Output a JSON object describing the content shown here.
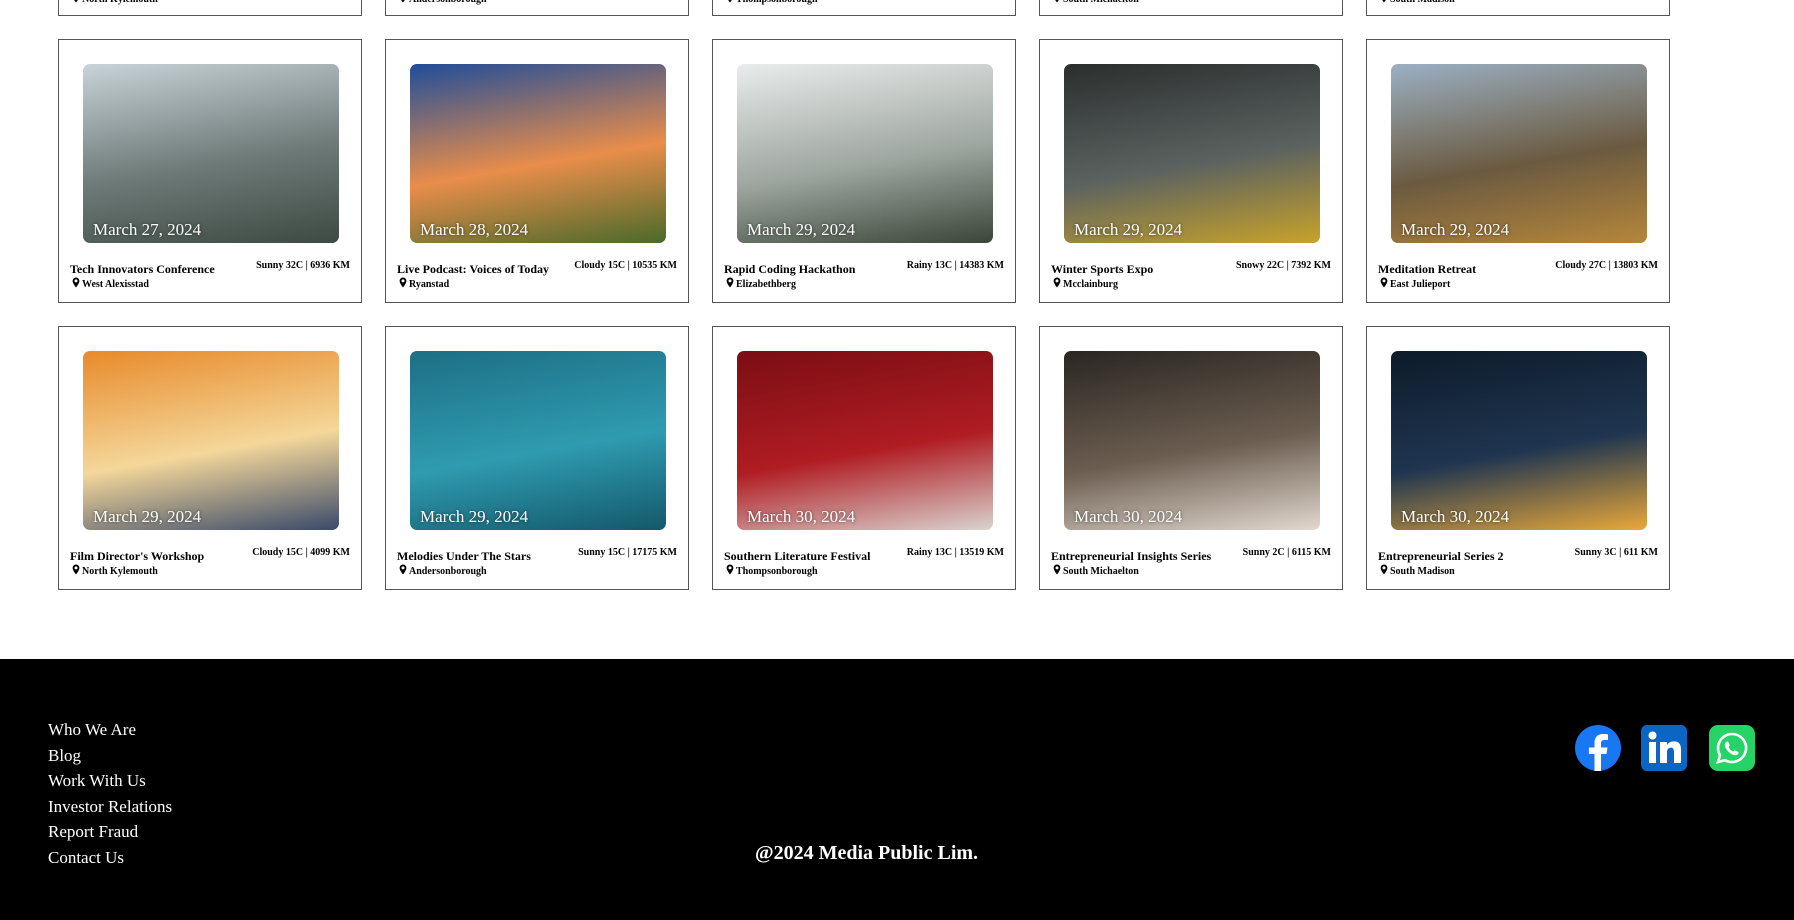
{
  "top_row": [
    {
      "location": "North Kylemouth"
    },
    {
      "location": "Andersonborough"
    },
    {
      "location": "Thompsonborough"
    },
    {
      "location": "South Michaelton"
    },
    {
      "location": "South Madison"
    }
  ],
  "events_row1": [
    {
      "date": "March 27, 2024",
      "title": "Tech Innovators Conference",
      "location": "West Alexisstad",
      "weather": "Sunny 32C | 6936 KM",
      "image": "mountain-fjord-photo",
      "colors": [
        "#c9d3d8",
        "#6d7a78",
        "#3d4a42"
      ]
    },
    {
      "date": "March 28, 2024",
      "title": "Live Podcast: Voices of Today",
      "location": "Ryanstad",
      "weather": "Cloudy 15C | 10535 KM",
      "image": "hot-air-balloons-photo",
      "colors": [
        "#1f4d9a",
        "#e98d4a",
        "#4a6a2a"
      ]
    },
    {
      "date": "March 29, 2024",
      "title": "Rapid Coding Hackathon",
      "location": "Elizabethberg",
      "weather": "Rainy 13C | 14383 KM",
      "image": "mountain-biker-photo",
      "colors": [
        "#e9ecec",
        "#9ea6a0",
        "#3a4638"
      ]
    },
    {
      "date": "March 29, 2024",
      "title": "Winter Sports Expo",
      "location": "Mcclainburg",
      "weather": "Snowy 22C | 7392 KM",
      "image": "kayak-canyon-photo",
      "colors": [
        "#2a2f2e",
        "#5b6260",
        "#c8a22a"
      ]
    },
    {
      "date": "March 29, 2024",
      "title": "Meditation Retreat",
      "location": "East Julieport",
      "weather": "Cloudy 27C | 13803 KM",
      "image": "hikers-mountain-photo",
      "colors": [
        "#9bb0c4",
        "#6b5a40",
        "#b5863a"
      ]
    }
  ],
  "events_row2": [
    {
      "date": "March 29, 2024",
      "title": "Film Director's Workshop",
      "location": "North Kylemouth",
      "weather": "Cloudy 15C | 4099 KM",
      "image": "tent-camper-photo",
      "colors": [
        "#e88a2a",
        "#f4d79a",
        "#3a4a6a"
      ]
    },
    {
      "date": "March 29, 2024",
      "title": "Melodies Under The Stars",
      "location": "Andersonborough",
      "weather": "Sunny 15C | 17175 KM",
      "image": "kayak-aerial-photo",
      "colors": [
        "#1d6f85",
        "#2f9bb0",
        "#14586a"
      ]
    },
    {
      "date": "March 30, 2024",
      "title": "Southern Literature Festival",
      "location": "Thompsonborough",
      "weather": "Rainy 13C | 13519 KM",
      "image": "mime-clapperboard-photo",
      "colors": [
        "#7a0e14",
        "#b01c22",
        "#d9d3cf"
      ]
    },
    {
      "date": "March 30, 2024",
      "title": "Entrepreneurial Insights Series",
      "location": "South Michaelton",
      "weather": "Sunny 2C | 6115 KM",
      "image": "concert-crowd-photo",
      "colors": [
        "#2a2622",
        "#6b5d50",
        "#e2d8cf"
      ]
    },
    {
      "date": "March 30, 2024",
      "title": "Entrepreneurial Series 2",
      "location": "South Madison",
      "weather": "Sunny 3C | 611 KM",
      "image": "night-tent-photo",
      "colors": [
        "#0d1b2a",
        "#1f3550",
        "#e9a83a"
      ]
    }
  ],
  "footer": {
    "links": [
      "Who We Are",
      "Blog",
      "Work With Us",
      "Investor Relations",
      "Report Fraud",
      "Contact Us"
    ],
    "copyright": "@2024 Media Public Lim.",
    "social": [
      "facebook-icon",
      "linkedin-icon",
      "whatsapp-icon"
    ],
    "colors": {
      "facebook": "#1877F2",
      "linkedin": "#0A66C2",
      "whatsapp": "#25D366"
    }
  }
}
